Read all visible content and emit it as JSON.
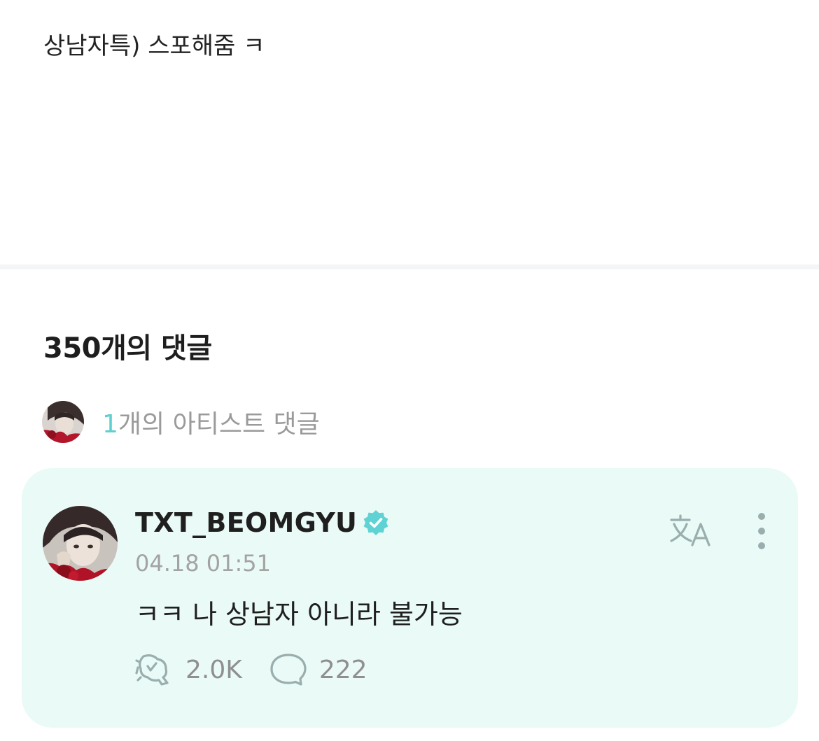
{
  "post": {
    "text": "상남자특) 스포해줌 ㅋ"
  },
  "comments": {
    "heading": "350개의 댓글",
    "artist_summary": {
      "count": "1",
      "label": "개의 아티스트 댓글"
    }
  },
  "comment": {
    "author": "TXT_BEOMGYU",
    "timestamp": "04.18 01:51",
    "text": "ㅋㅋ 나 상남자 아니라 불가능",
    "likes": "2.0K",
    "replies": "222",
    "icons": {
      "verified": "verified-badge-icon",
      "translate": "translate-icon",
      "more": "more-vertical-icon",
      "like": "like-icon",
      "reply": "reply-bubble-icon"
    }
  },
  "colors": {
    "accent": "#5fcfd0",
    "card_background": "#eafaf6",
    "divider": "#f4f5f6",
    "muted_text": "#9a9a9a"
  }
}
